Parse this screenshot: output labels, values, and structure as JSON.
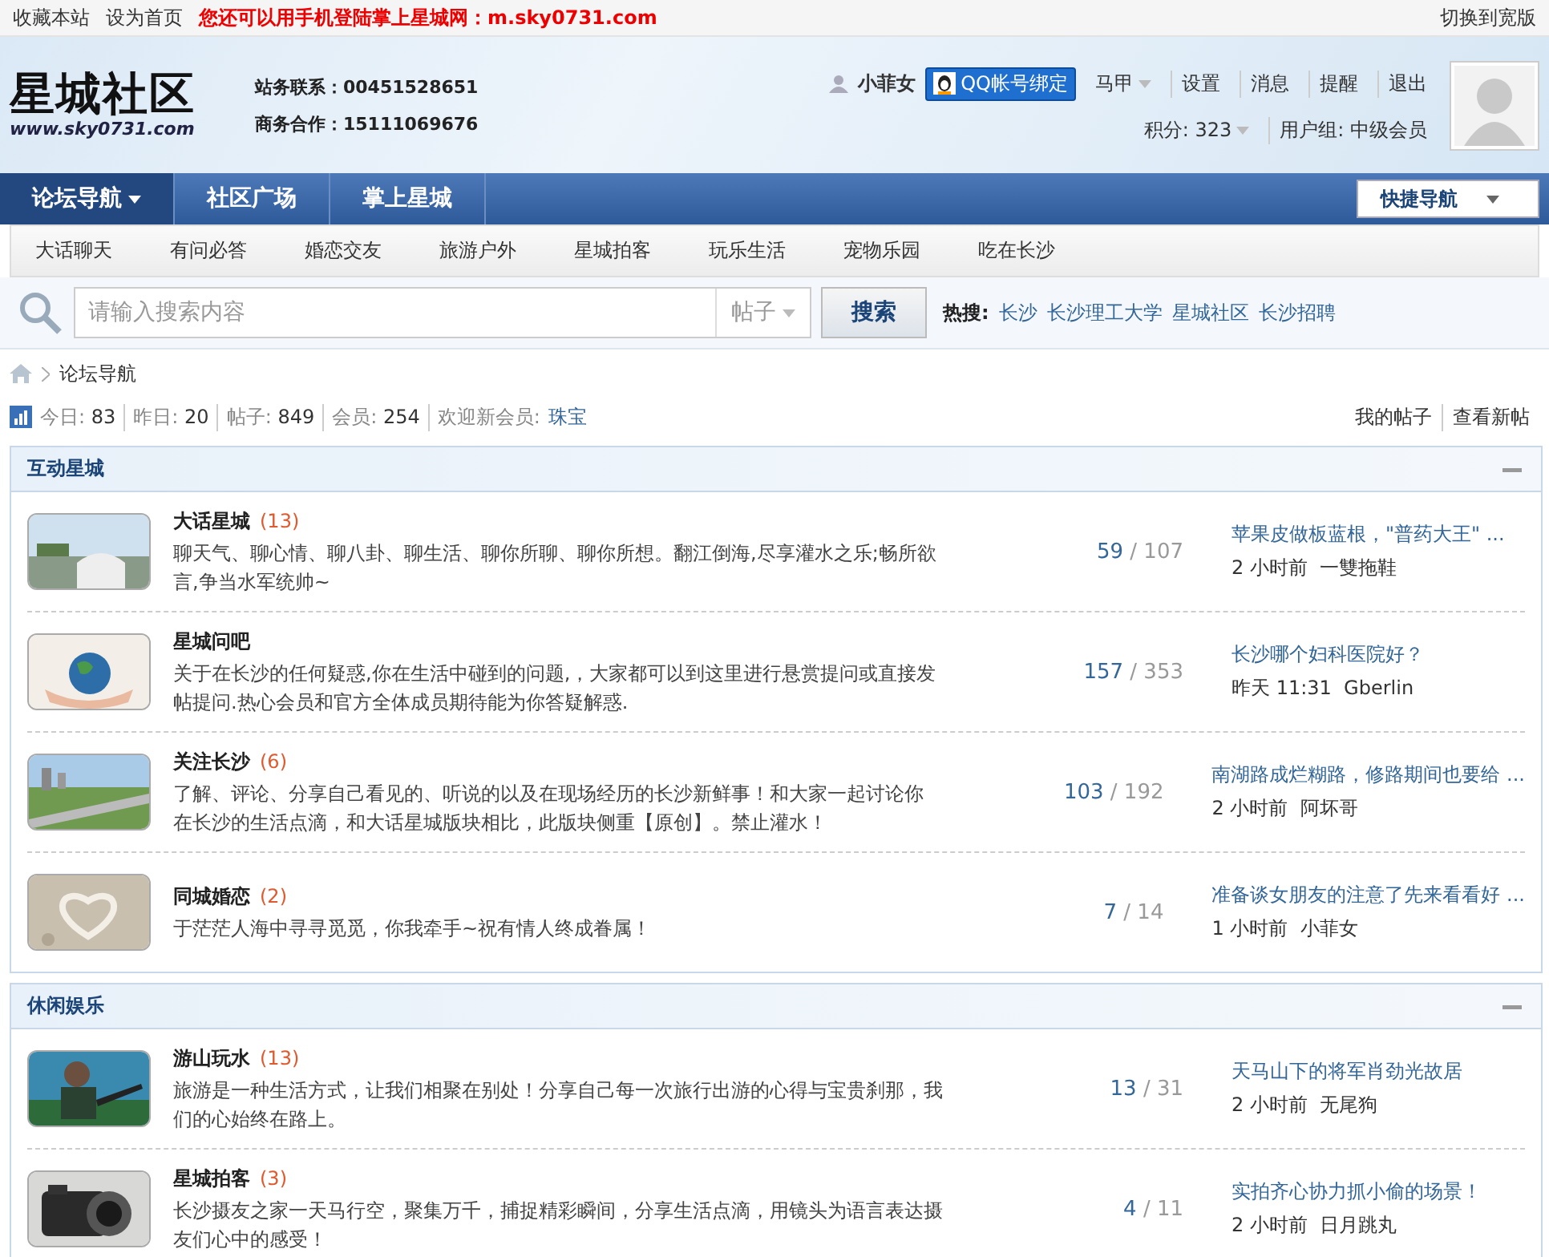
{
  "top_bar": {
    "links": [
      "收藏本站",
      "设为首页"
    ],
    "notice": "您还可以用手机登陆掌上星城网：m.sky0731.com",
    "switch": "切换到宽版"
  },
  "header": {
    "logo": {
      "title": "星城社区",
      "url": "www.sky0731.com"
    },
    "contacts": [
      "站务联系：00451528651",
      "商务合作：15111069676"
    ],
    "user": {
      "name": "小菲女",
      "qq_button": "QQ帐号绑定",
      "links": [
        {
          "label": "马甲",
          "dropdown": true
        },
        {
          "label": "设置",
          "dropdown": false
        },
        {
          "label": "消息",
          "dropdown": false
        },
        {
          "label": "提醒",
          "dropdown": false
        },
        {
          "label": "退出",
          "dropdown": false
        }
      ],
      "points": "积分: 323",
      "group": "用户组: 中级会员"
    }
  },
  "nav": {
    "items": [
      {
        "label": "论坛导航",
        "selected": true,
        "dropdown": true
      },
      {
        "label": "社区广场",
        "selected": false,
        "dropdown": false
      },
      {
        "label": "掌上星城",
        "selected": false,
        "dropdown": false
      }
    ],
    "quick_nav": "快捷导航"
  },
  "subnav": [
    "大话聊天",
    "有问必答",
    "婚恋交友",
    "旅游户外",
    "星城拍客",
    "玩乐生活",
    "宠物乐园",
    "吃在长沙"
  ],
  "search": {
    "placeholder": "请输入搜索内容",
    "type": "帖子",
    "button": "搜索",
    "hot_label": "热搜:",
    "hot": [
      "长沙",
      "长沙理工大学",
      "星城社区",
      "长沙招聘"
    ]
  },
  "breadcrumb": "论坛导航",
  "stats": {
    "items": [
      {
        "label": "今日:",
        "value": "83"
      },
      {
        "label": "昨日:",
        "value": "20"
      },
      {
        "label": "帖子:",
        "value": "849"
      },
      {
        "label": "会员:",
        "value": "254"
      }
    ],
    "new_member_label": "欢迎新会员:",
    "new_member": "珠宝",
    "links": [
      "我的帖子",
      "查看新帖"
    ]
  },
  "sections": [
    {
      "title": "互动星城",
      "collapsed": false,
      "forums": [
        {
          "name": "大话星城",
          "today": "(13)",
          "description": "聊天气、聊心情、聊八卦、聊生活、聊你所聊、聊你所想。翻江倒海,尽享灌水之乐;畅所欲言,争当水军统帅~",
          "threads": "59",
          "posts": "/ 107",
          "last_title": "苹果皮做板蓝根，\"普药大王\" ...",
          "last_time": "2 小时前",
          "last_user": "一雙拖鞋"
        },
        {
          "name": "星城问吧",
          "description": "关于在长沙的任何疑惑,你在生活中碰到的问题,，大家都可以到这里进行悬赏提问或直接发帖提问.热心会员和官方全体成员期待能为你答疑解惑.",
          "threads": "157",
          "posts": "/ 353",
          "last_title": "长沙哪个妇科医院好？",
          "last_time": "昨天 11:31",
          "last_user": "Gberlin"
        },
        {
          "name": "关注长沙",
          "today": "(6)",
          "description": "了解、评论、分享自己看见的、听说的以及在现场经历的长沙新鲜事！和大家一起讨论你在长沙的生活点滴，和大话星城版块相比，此版块侧重【原创】。禁止灌水！",
          "threads": "103",
          "posts": "/ 192",
          "last_title": "南湖路成烂糊路，修路期间也要给 ...",
          "last_time": "2 小时前",
          "last_user": "阿坏哥"
        },
        {
          "name": "同城婚恋",
          "today": "(2)",
          "description": "于茫茫人海中寻寻觅觅，你我牵手~祝有情人终成眷属！",
          "threads": "7",
          "posts": "/ 14",
          "last_title": "准备谈女朋友的注意了先来看看好 ...",
          "last_time": "1 小时前",
          "last_user": "小菲女"
        }
      ]
    },
    {
      "title": "休闲娱乐",
      "collapsed": false,
      "forums": [
        {
          "name": "游山玩水",
          "today": "(13)",
          "description": "旅游是一种生活方式，让我们相聚在别处！分享自己每一次旅行出游的心得与宝贵刹那，我们的心始终在路上。",
          "threads": "13",
          "posts": "/ 31",
          "last_title": "天马山下的将军肖劲光故居",
          "last_time": "2 小时前",
          "last_user": "无尾狗"
        },
        {
          "name": "星城拍客",
          "today": "(3)",
          "description": "长沙摄友之家一天马行空，聚集万千，捕捉精彩瞬间，分享生活点滴，用镜头为语言表达摄友们心中的感受！",
          "threads": "4",
          "posts": "/ 11",
          "last_title": "实拍齐心协力抓小偷的场景！",
          "last_time": "2 小时前",
          "last_user": "日月跳丸"
        }
      ]
    }
  ]
}
